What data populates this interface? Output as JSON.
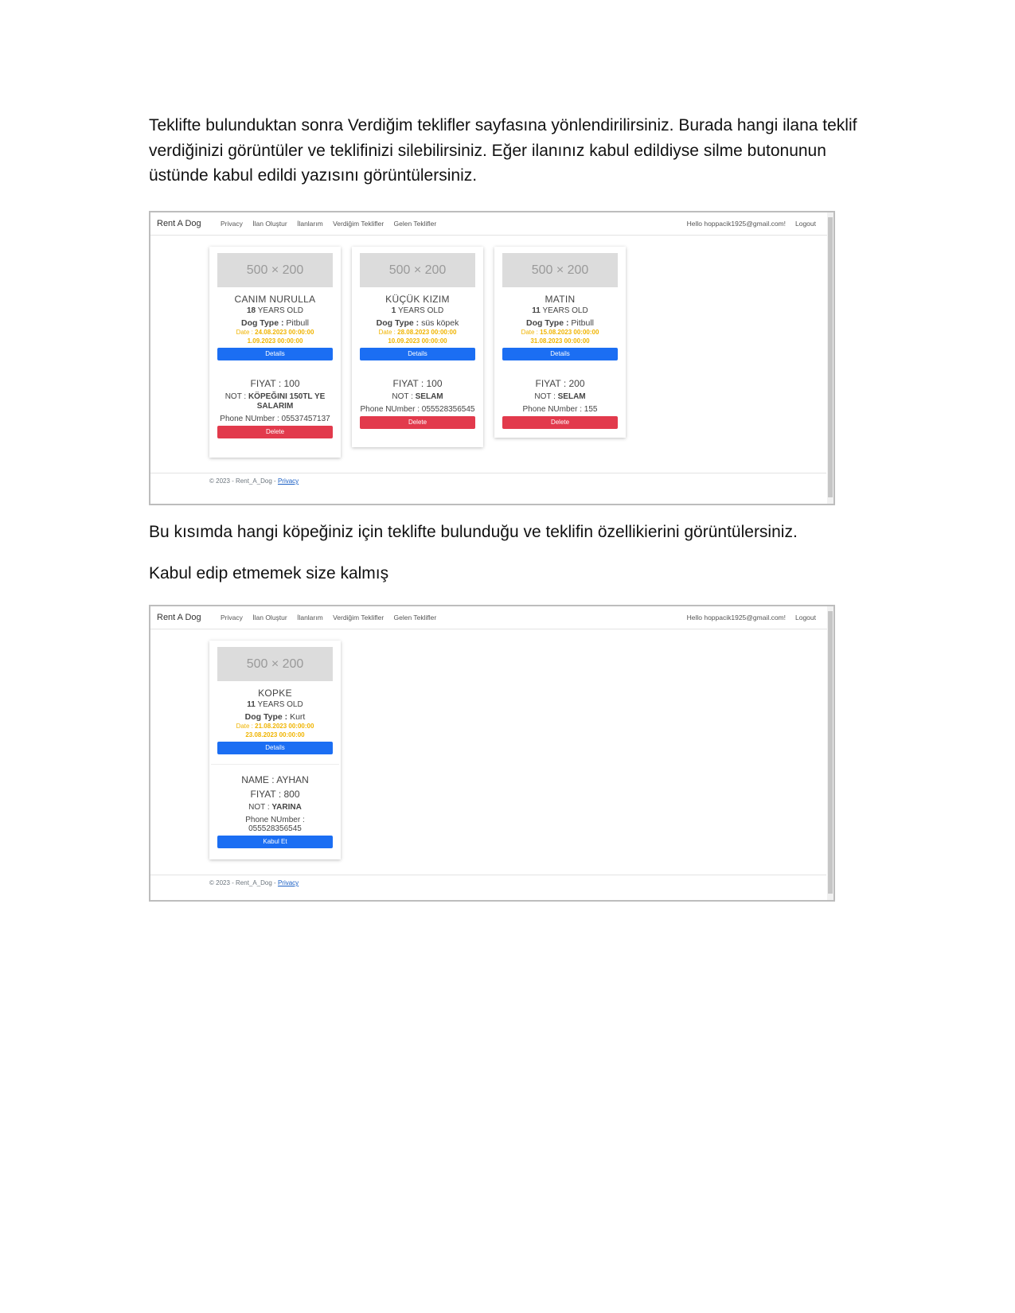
{
  "doc": {
    "para1": "Teklifte bulunduktan sonra Verdiğim teklifler sayfasına yönlendirilirsiniz. Burada hangi ilana teklif verdiğinizi görüntüler ve teklifinizi silebilirsiniz. Eğer ilanınız kabul edildiyse silme butonunun üstünde kabul edildi yazısını görüntülersiniz.",
    "para2": "Bu kısımda hangi köpeğiniz için teklifte bulunduğu ve teklifin özellikierini görüntülersiniz.",
    "para3": "Kabul edip etmemek size kalmış"
  },
  "nav": {
    "brand": "Rent A Dog",
    "links": [
      "Privacy",
      "İlan Oluştur",
      "İlanlarım",
      "Verdiğim Teklifler",
      "Gelen Teklifler"
    ],
    "hello": "Hello hoppacik1925@gmail.com!",
    "logout": "Logout"
  },
  "footer": {
    "text": "© 2023 - Rent_A_Dog - ",
    "link": "Privacy"
  },
  "placeholder": "500 × 200",
  "screen1": {
    "cards": [
      {
        "name": "CANIM NURULLA",
        "age": "18",
        "age_label": "YEARS OLD",
        "type_label": "Dog Type :",
        "type": "Pitbull",
        "date_label": "Date :",
        "date_start": "24.08.2023 00:00:00",
        "date_end": "1.09.2023 00:00:00",
        "details": "Details",
        "fiyat": "FIYAT : 100",
        "not_label": "NOT :",
        "not": "KÖPEĞINI 150TL YE SALARIM",
        "phone": "Phone NUmber : 05537457137",
        "delete": "Delete"
      },
      {
        "name": "KÜÇÜK KIZIM",
        "age": "1",
        "age_label": "YEARS OLD",
        "type_label": "Dog Type :",
        "type": "süs köpek",
        "date_label": "Date :",
        "date_start": "28.08.2023 00:00:00",
        "date_end": "10.09.2023 00:00:00",
        "details": "Details",
        "fiyat": "FIYAT : 100",
        "not_label": "NOT :",
        "not": "SELAM",
        "phone": "Phone NUmber : 055528356545",
        "delete": "Delete"
      },
      {
        "name": "MATIN",
        "age": "11",
        "age_label": "YEARS OLD",
        "type_label": "Dog Type :",
        "type": "Pitbull",
        "date_label": "Date :",
        "date_start": "15.08.2023 00:00:00",
        "date_end": "31.08.2023 00:00:00",
        "details": "Details",
        "fiyat": "FIYAT : 200",
        "not_label": "NOT :",
        "not": "SELAM",
        "phone": "Phone NUmber : 155",
        "delete": "Delete"
      }
    ]
  },
  "screen2": {
    "card": {
      "name": "KOPKE",
      "age": "11",
      "age_label": "YEARS OLD",
      "type_label": "Dog Type :",
      "type": "Kurt",
      "date_label": "Date :",
      "date_start": "21.08.2023 00:00:00",
      "date_end": "23.08.2023 00:00:00",
      "details": "Details",
      "offer_name": "NAME : AYHAN",
      "fiyat": "FIYAT : 800",
      "not_label": "NOT :",
      "not": "YARINA",
      "phone_label": "Phone NUmber :",
      "phone": "055528356545",
      "accept": "Kabul Et"
    }
  },
  "colors": {
    "primary": "#1b6ef3",
    "danger": "#e23a4c",
    "date": "#f0b400"
  }
}
